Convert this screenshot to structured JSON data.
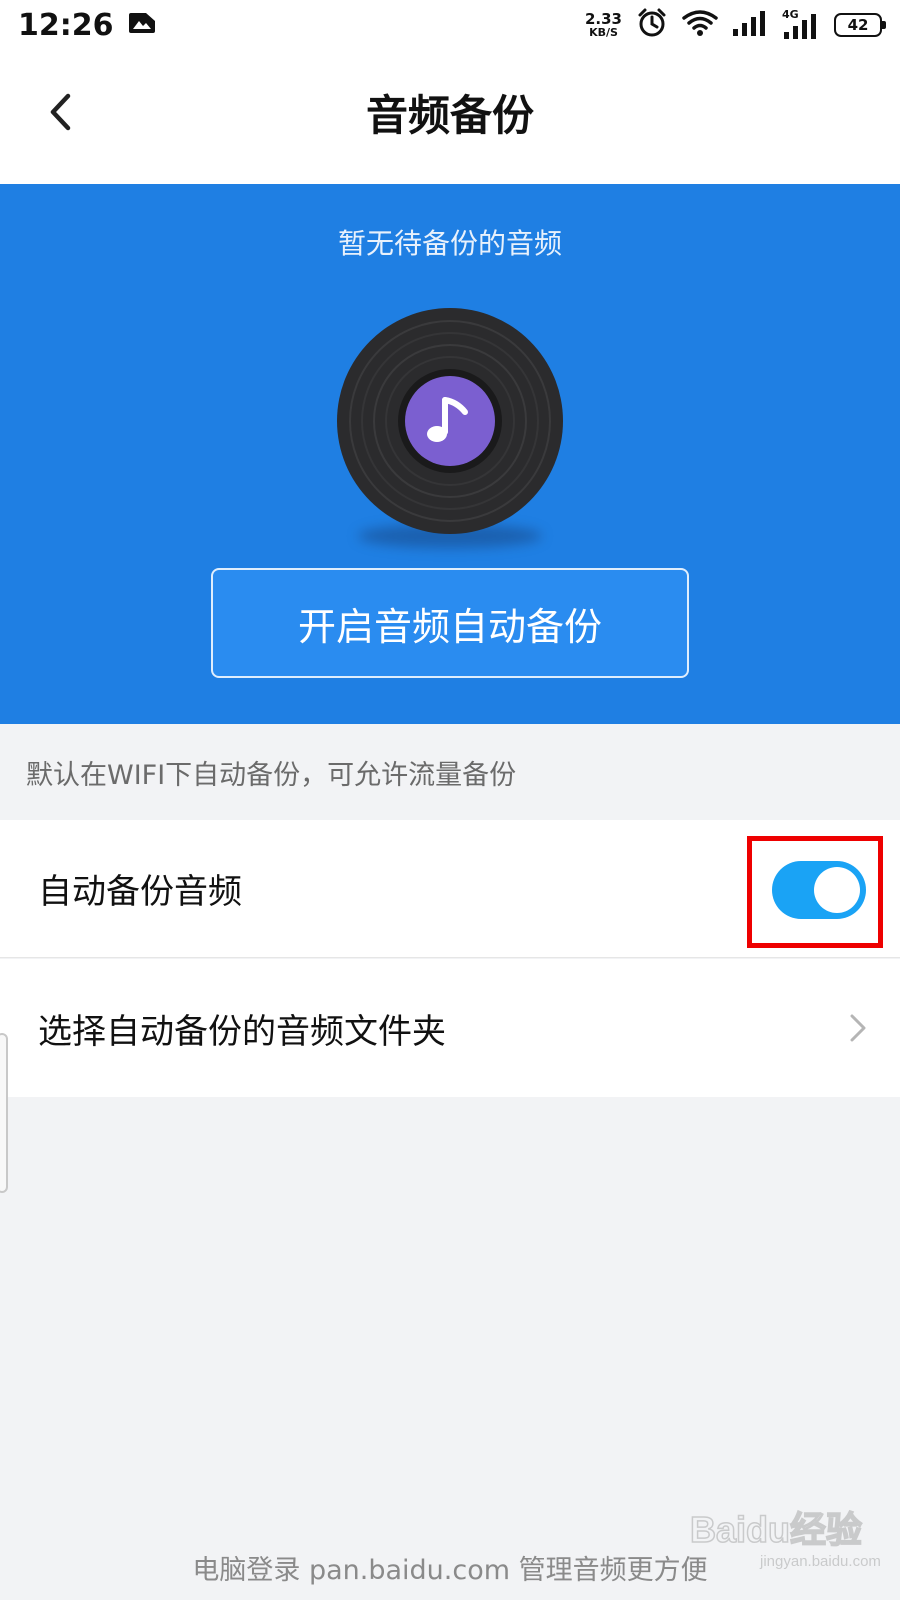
{
  "status_bar": {
    "time": "12:26",
    "net_speed_value": "2.33",
    "net_speed_unit": "KB/S",
    "network_type": "4G",
    "battery": "42",
    "icons": [
      "image-notification-icon",
      "alarm-icon",
      "wifi-icon",
      "signal-icon",
      "signal-4g-icon",
      "battery-icon"
    ]
  },
  "header": {
    "title": "音频备份"
  },
  "banner": {
    "message": "暂无待备份的音频",
    "enable_button_label": "开启音频自动备份",
    "background_color": "#1f7fe3",
    "disc_icon": "vinyl-music-note-icon"
  },
  "hint": {
    "text": "默认在WIFI下自动备份，可允许流量备份"
  },
  "settings": {
    "auto_backup": {
      "label": "自动备份音频",
      "enabled": true,
      "toggle_color": "#1aa3f5",
      "highlight_color": "#ee0000"
    },
    "folder": {
      "label": "选择自动备份的音频文件夹"
    }
  },
  "footer": {
    "text": "电脑登录 pan.baidu.com 管理音频更方便"
  },
  "watermark": {
    "brand": "Baidu经验",
    "url": "jingyan.baidu.com"
  }
}
